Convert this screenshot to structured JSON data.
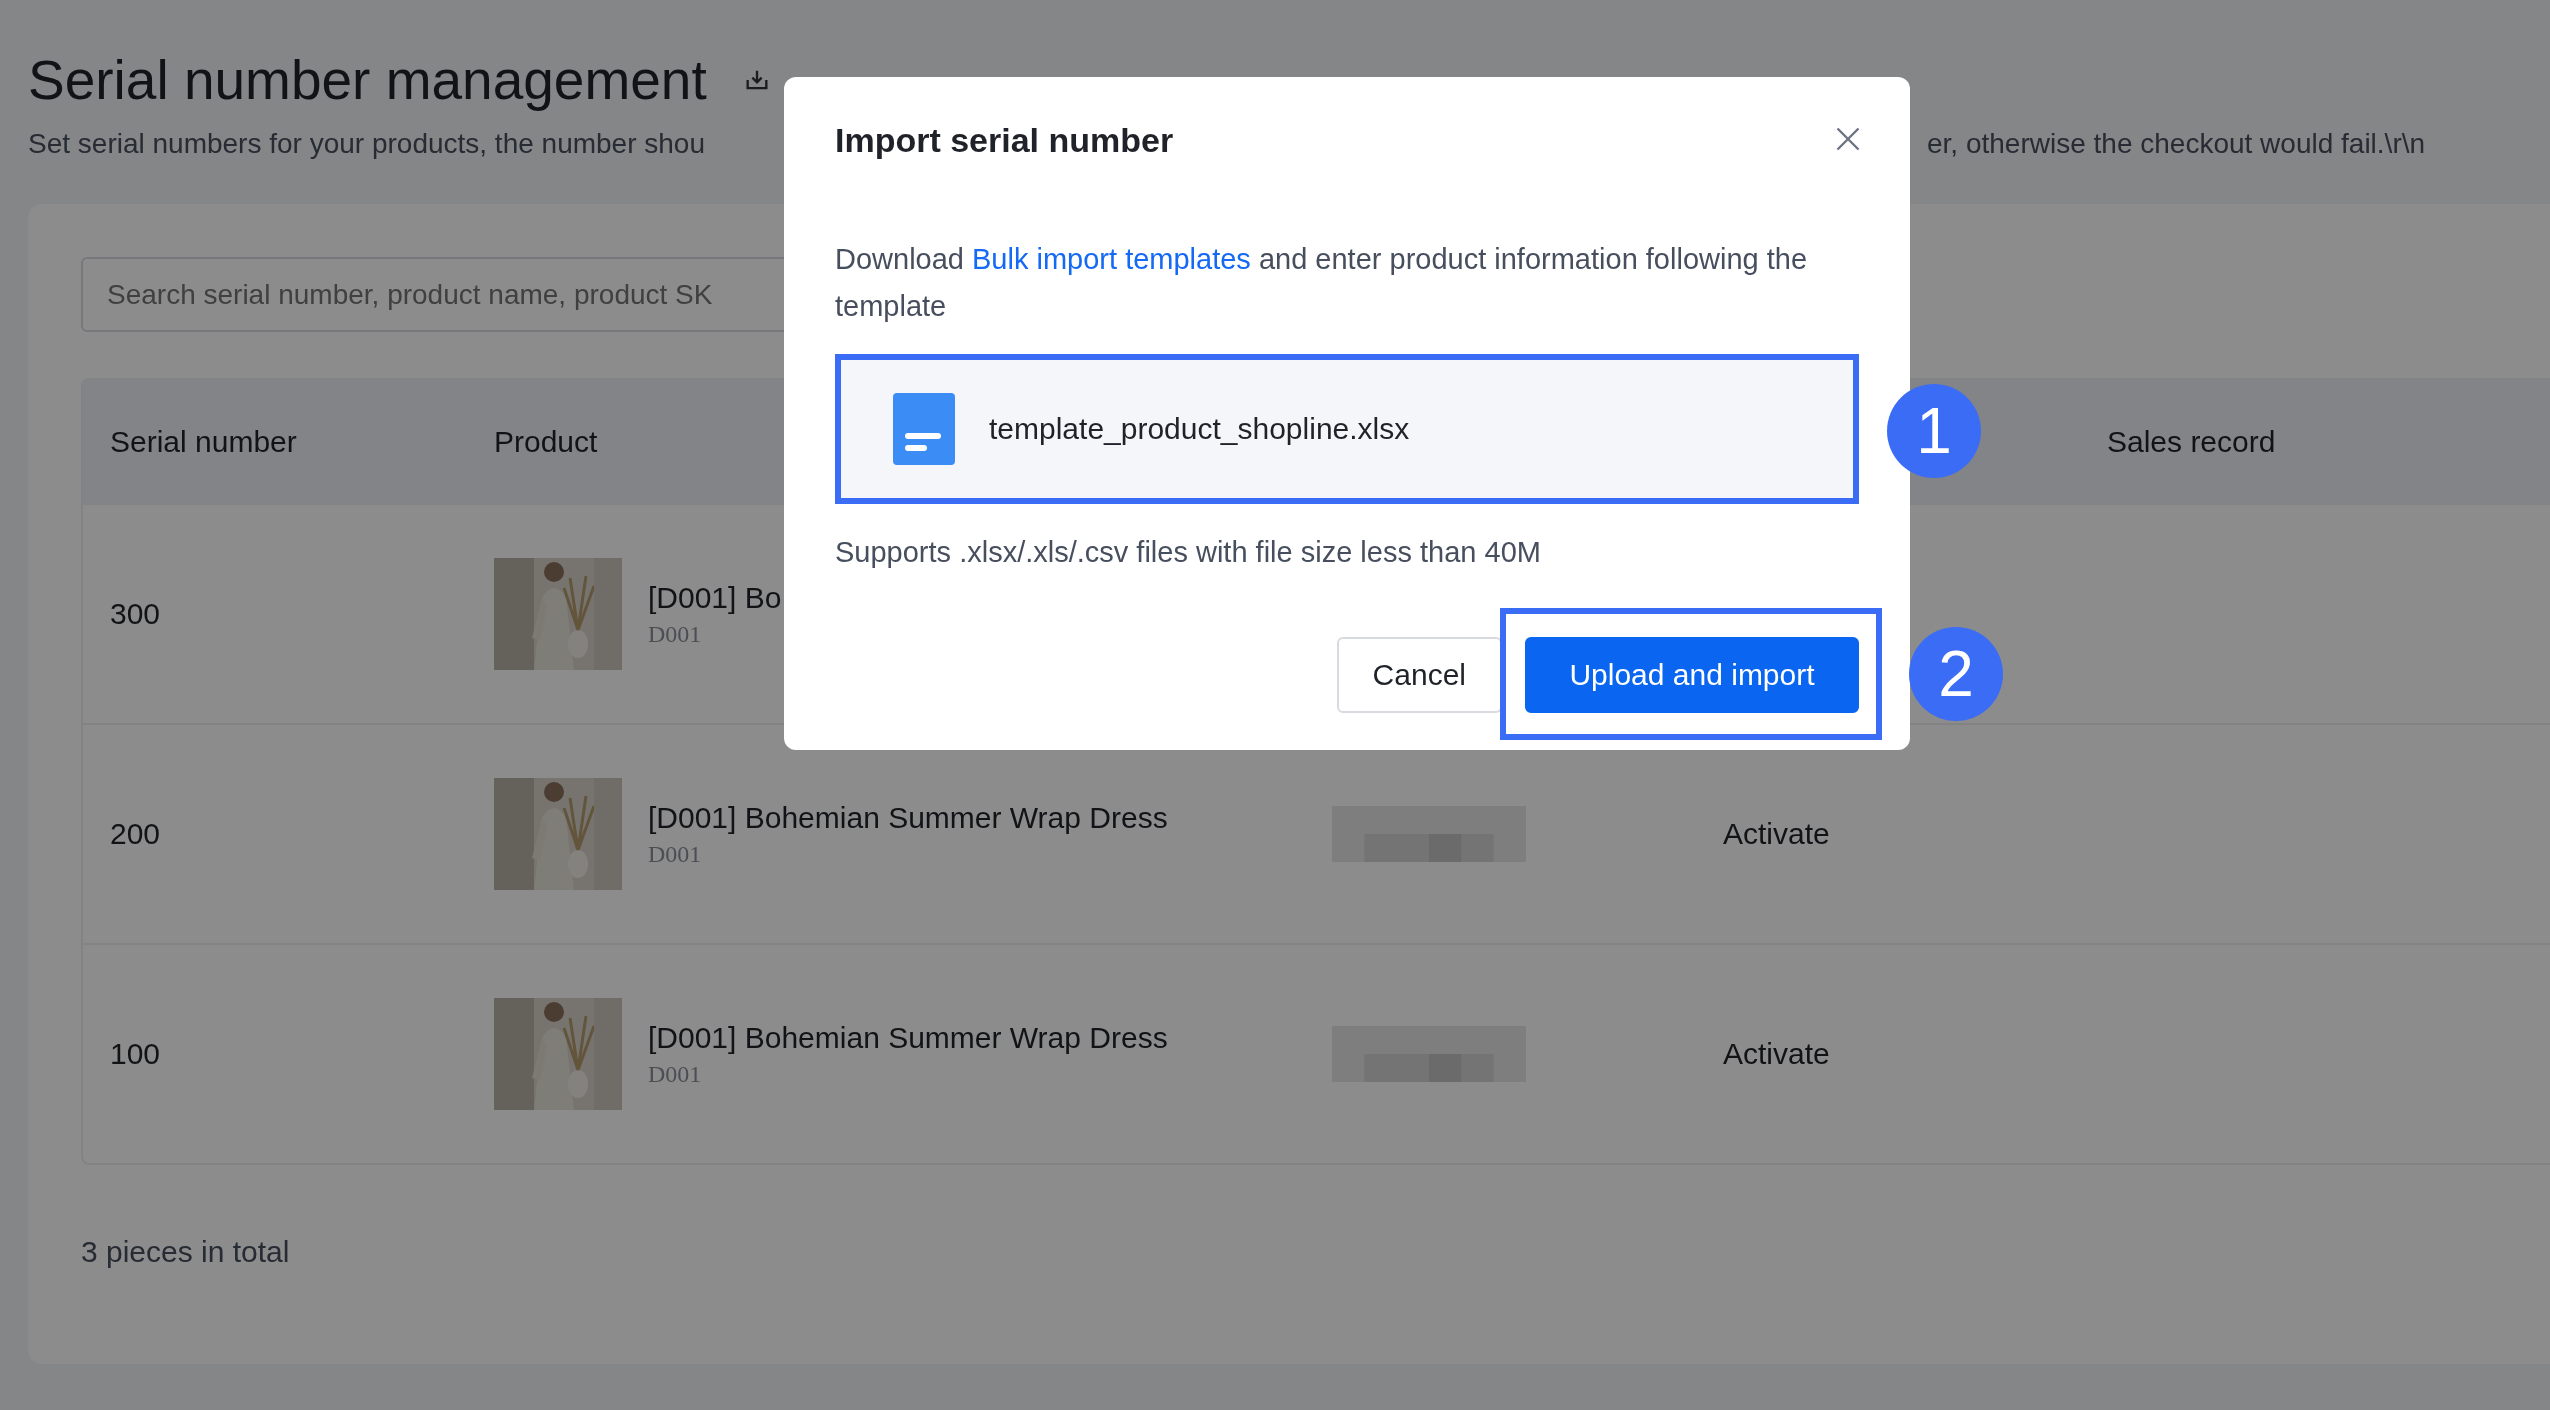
{
  "page": {
    "title": "Serial number management",
    "description_start": "Set serial numbers for your products, the number shou",
    "description_end": "er, otherwise the checkout would fail.\\r\\n"
  },
  "search": {
    "placeholder": "Search serial number, product name, product SK"
  },
  "table": {
    "columns": [
      "Serial number",
      "Product",
      "",
      "",
      "Sales record"
    ],
    "rows": [
      {
        "serial": "300",
        "product": "[D001] Bo",
        "sku": "D001"
      },
      {
        "serial": "200",
        "product": "[D001] Bohemian Summer Wrap Dress",
        "sku": "D001",
        "redacted": true,
        "status": "Activate"
      },
      {
        "serial": "100",
        "product": "[D001] Bohemian Summer Wrap Dress",
        "sku": "D001",
        "redacted": true,
        "status": "Activate"
      }
    ]
  },
  "footer": {
    "total": "3 pieces in total"
  },
  "dialog": {
    "title": "Import serial number",
    "intro_before": "Download ",
    "link": "Bulk import templates",
    "intro_after": " and enter product information following the template",
    "file": "template_product_shopline.xlsx",
    "hint": "Supports .xlsx/.xls/.csv files with file size less than 40M",
    "buttons": [
      {
        "label": "Cancel",
        "kind": "secondary"
      },
      {
        "label": "Upload and import",
        "kind": "primary"
      }
    ]
  },
  "annotations": [
    "1",
    "2"
  ]
}
